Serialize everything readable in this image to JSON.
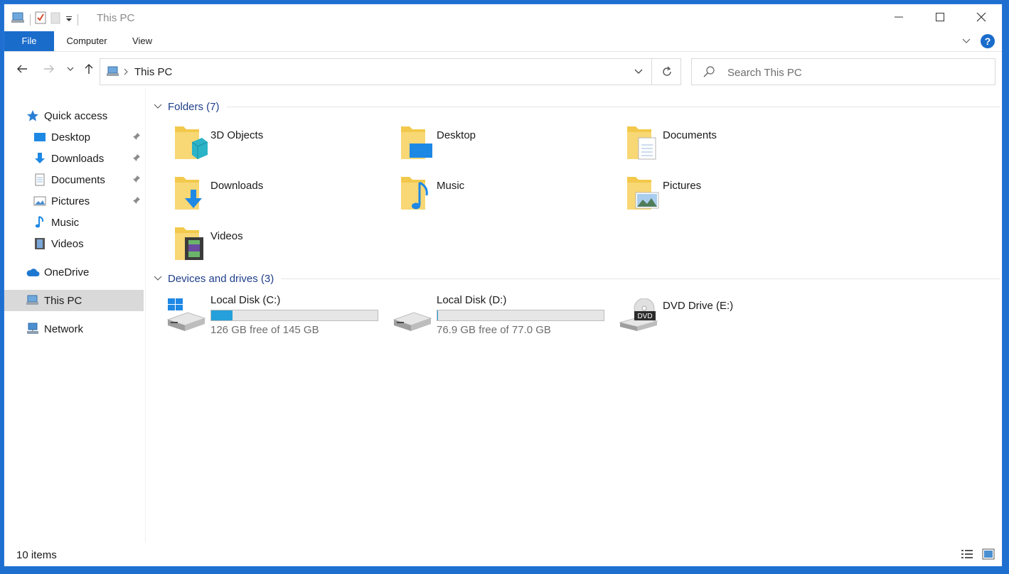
{
  "window": {
    "title": "This PC",
    "accent_color": "#1a6ccb"
  },
  "ribbon": {
    "tabs": [
      "File",
      "Computer",
      "View"
    ]
  },
  "address": {
    "crumb": "This PC",
    "search_placeholder": "Search This PC"
  },
  "sidebar": {
    "quick_access": "Quick access",
    "items": [
      {
        "label": "Desktop",
        "icon": "desktop-icon",
        "pinned": true
      },
      {
        "label": "Downloads",
        "icon": "downloads-icon",
        "pinned": true
      },
      {
        "label": "Documents",
        "icon": "documents-icon",
        "pinned": true
      },
      {
        "label": "Pictures",
        "icon": "pictures-icon",
        "pinned": true
      },
      {
        "label": "Music",
        "icon": "music-icon",
        "pinned": false
      },
      {
        "label": "Videos",
        "icon": "videos-icon",
        "pinned": false
      }
    ],
    "onedrive": "OneDrive",
    "this_pc": "This PC",
    "network": "Network"
  },
  "folders": {
    "header": "Folders (7)",
    "items": [
      "3D Objects",
      "Desktop",
      "Documents",
      "Downloads",
      "Music",
      "Pictures",
      "Videos"
    ]
  },
  "drives": {
    "header": "Devices and drives (3)",
    "items": [
      {
        "label": "Local Disk (C:)",
        "free": "126 GB free of 145 GB",
        "used_fraction": 0.13
      },
      {
        "label": "Local Disk (D:)",
        "free": "76.9 GB free of 77.0 GB",
        "used_fraction": 0.001
      },
      {
        "label": "DVD Drive (E:)"
      }
    ]
  },
  "status": {
    "count": "10 items"
  }
}
